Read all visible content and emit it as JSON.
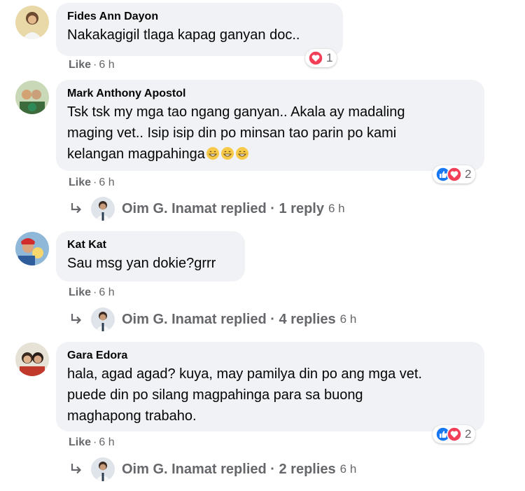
{
  "comments": [
    {
      "author": "Fides Ann Dayon",
      "lines": [
        "Nakakagigil tlaga kapag ganyan doc.."
      ],
      "like_label": "Like",
      "time": "6 h",
      "reactions": {
        "icons": [
          "love-icon"
        ],
        "count": "1"
      }
    },
    {
      "author": "Mark Anthony Apostol",
      "lines": [
        "Tsk tsk my mga tao ngang ganyan.. Akala ay madaling",
        "maging vet.. Isip isip din po minsan tao parin po kami",
        "kelangan magpahinga"
      ],
      "trailing_emoji": [
        "grin-emoji",
        "grin-emoji",
        "grin-emoji"
      ],
      "like_label": "Like",
      "time": "6 h",
      "reactions": {
        "icons": [
          "like-icon",
          "love-icon"
        ],
        "count": "2"
      },
      "reply": {
        "text": "Oim G. Inamat replied · 1 reply",
        "time": "6 h"
      }
    },
    {
      "author": "Kat Kat",
      "lines": [
        "Sau msg yan dokie?grrr"
      ],
      "like_label": "Like",
      "time": "6 h",
      "reply": {
        "text": "Oim G. Inamat replied · 4 replies",
        "time": "6 h"
      }
    },
    {
      "author": "Gara Edora",
      "lines": [
        "hala, agad agad? kuya, may pamilya din po ang mga vet.",
        "puede din po silang magpahinga para sa buong",
        "maghapong trabaho."
      ],
      "like_label": "Like",
      "time": "6 h",
      "reactions": {
        "icons": [
          "like-icon",
          "love-icon"
        ],
        "count": "2"
      },
      "reply": {
        "text": "Oim G. Inamat replied · 2 replies",
        "time": "6 h"
      }
    }
  ],
  "colors": {
    "bubble": "#f0f2f5",
    "secondary_text": "#65676b",
    "like_blue": "#1877f2",
    "love_red": "#f33e58"
  }
}
